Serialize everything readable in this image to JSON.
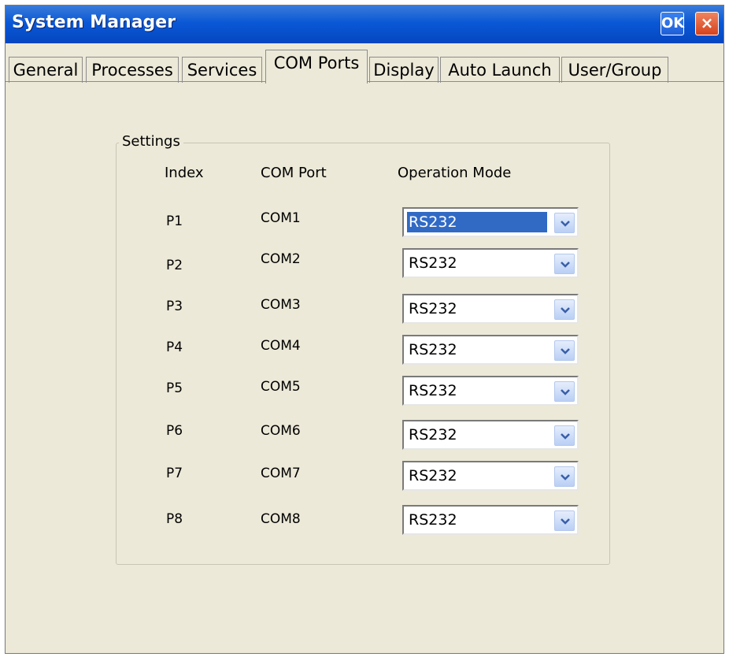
{
  "window": {
    "title": "System Manager",
    "ok_label": "OK",
    "close_label": "×"
  },
  "tabs": [
    {
      "label": "General"
    },
    {
      "label": "Processes"
    },
    {
      "label": "Services"
    },
    {
      "label": "COM Ports",
      "active": true
    },
    {
      "label": "Display"
    },
    {
      "label": "Auto Launch"
    },
    {
      "label": "User/Group"
    }
  ],
  "settings": {
    "label": "Settings",
    "headers": {
      "index": "Index",
      "com_port": "COM Port",
      "operation_mode": "Operation Mode"
    },
    "rows": [
      {
        "index": "P1",
        "port": "COM1",
        "mode": "RS232",
        "selected": true
      },
      {
        "index": "P2",
        "port": "COM2",
        "mode": "RS232"
      },
      {
        "index": "P3",
        "port": "COM3",
        "mode": "RS232"
      },
      {
        "index": "P4",
        "port": "COM4",
        "mode": "RS232"
      },
      {
        "index": "P5",
        "port": "COM5",
        "mode": "RS232"
      },
      {
        "index": "P6",
        "port": "COM6",
        "mode": "RS232"
      },
      {
        "index": "P7",
        "port": "COM7",
        "mode": "RS232"
      },
      {
        "index": "P8",
        "port": "COM8",
        "mode": "RS232"
      }
    ]
  },
  "icons": {
    "dropdown": "chevron-down-icon"
  },
  "colors": {
    "titlebar": "#0a58d6",
    "window_bg": "#ECE9D8",
    "selection": "#316AC5",
    "close": "#d6421c"
  }
}
